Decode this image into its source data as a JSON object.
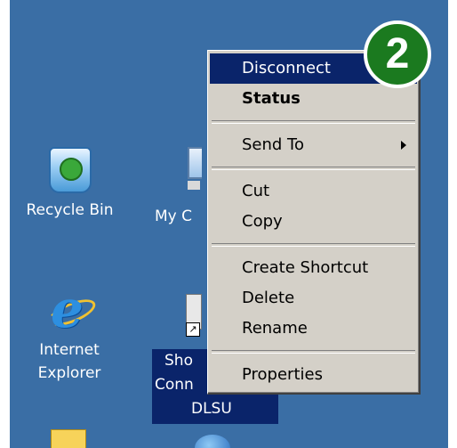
{
  "desktop": {
    "background_color": "#3a6ea5",
    "icons": {
      "recycle_bin": {
        "label": "Recycle Bin",
        "icon": "recycle-bin-icon"
      },
      "my_computer": {
        "label": "My C",
        "icon": "my-computer-icon"
      },
      "internet_explorer": {
        "line1": "Internet",
        "line2": "Explorer",
        "icon": "internet-explorer-icon"
      },
      "shortcut": {
        "line1": "Sho",
        "line2": "Conn",
        "line3": "DLSU",
        "icon": "shortcut-connection-icon"
      }
    }
  },
  "context_menu": {
    "items": [
      {
        "label": "Disconnect",
        "highlighted": true
      },
      {
        "label": "Status",
        "bold": true
      },
      {
        "label": "Send To",
        "submenu": true
      },
      {
        "label": "Cut"
      },
      {
        "label": "Copy"
      },
      {
        "label": "Create Shortcut"
      },
      {
        "label": "Delete"
      },
      {
        "label": "Rename"
      },
      {
        "label": "Properties"
      }
    ],
    "highlight_color": "#0a246a",
    "background_color": "#d4d0c8"
  },
  "step_badge": {
    "number": "2",
    "color": "#1b7a1f"
  }
}
